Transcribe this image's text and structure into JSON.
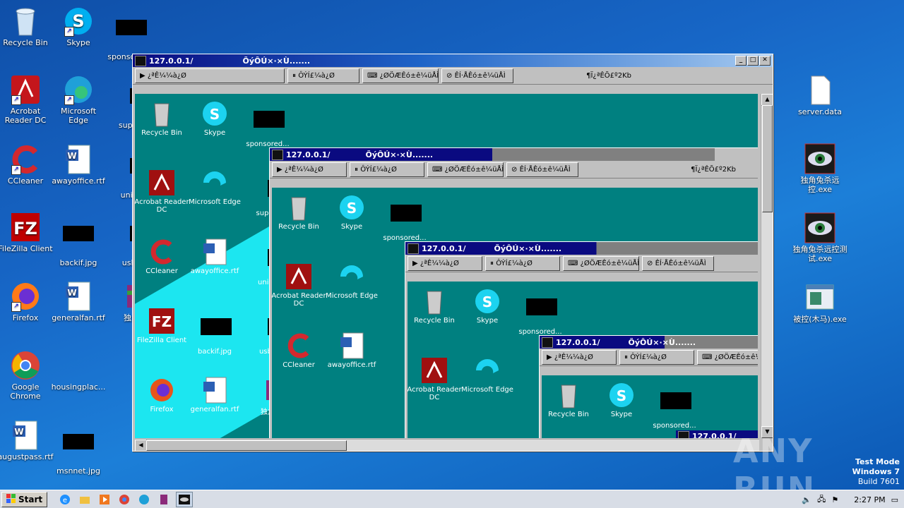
{
  "desktop": {
    "left_icons": [
      {
        "label": "Recycle Bin",
        "icon": "recycle-bin"
      },
      {
        "label": "Skype",
        "icon": "skype"
      },
      {
        "label": "sponsored...",
        "icon": "redacted"
      },
      {
        "label": "Acrobat Reader DC",
        "icon": "acrobat"
      },
      {
        "label": "Microsoft Edge",
        "icon": "edge"
      },
      {
        "label": "supply",
        "icon": "redacted"
      },
      {
        "label": "CCleaner",
        "icon": "ccleaner"
      },
      {
        "label": "awayoffice.rtf",
        "icon": "word-doc"
      },
      {
        "label": "union",
        "icon": "redacted"
      },
      {
        "label": "FileZilla Client",
        "icon": "filezilla"
      },
      {
        "label": "backif.jpg",
        "icon": "redacted"
      },
      {
        "label": "usbe",
        "icon": "redacted"
      },
      {
        "label": "Firefox",
        "icon": "firefox"
      },
      {
        "label": "generalfan.rtf",
        "icon": "word-doc"
      },
      {
        "label": "独角",
        "icon": "winrar"
      },
      {
        "label": "Google Chrome",
        "icon": "chrome"
      },
      {
        "label": "housingplac...",
        "icon": "blank"
      },
      {
        "label": "augustpass.rtf",
        "icon": "word-doc"
      },
      {
        "label": "msnnet.jpg",
        "icon": "redacted"
      }
    ],
    "right_icons": [
      {
        "label": "server.data",
        "icon": "blank-file"
      },
      {
        "label": "独角兔杀远控.exe",
        "icon": "eye-exe"
      },
      {
        "label": "独角兔杀远控测试.exe",
        "icon": "eye-exe"
      },
      {
        "label": "被控(木马).exe",
        "icon": "exe-window"
      }
    ]
  },
  "rat_window": {
    "title": "127.0.0.1/",
    "title_extra": "ÕýÔÚ×·×Ù.......",
    "buttons": {
      "minimize": "_",
      "maximize": "□",
      "close": "✕"
    },
    "toolbar": [
      {
        "label": "¿ªÊ¼¼à¿Ø",
        "icon": "play-icon"
      },
      {
        "label": "ÔÝÍ£¼à¿Ø",
        "icon": "pause-icon"
      },
      {
        "label": "¿ØÖÆÊó±ê¼üÅÌ",
        "icon": "keyboard-icon"
      },
      {
        "label": "ÊÍ·ÅÊó±ê¼üÅÌ",
        "icon": "release-icon"
      }
    ],
    "status": "¶Ï¿ªÊÕ£º2Kb",
    "remote_icons": [
      "Recycle Bin",
      "Skype",
      "sponsored...",
      "Acrobat Reader DC",
      "Microsoft Edge",
      "supply",
      "CCleaner",
      "awayoffice.rtf",
      "union",
      "FileZilla Client",
      "backif.jpg",
      "usbe",
      "Firefox",
      "generalfan.rtf",
      "独角"
    ]
  },
  "watermark": {
    "text": "ANY RUN"
  },
  "test_mode": {
    "line1": "Test Mode",
    "line2": "Windows 7",
    "line3": "Build 7601"
  },
  "taskbar": {
    "start_label": "Start",
    "clock": "2:27 PM"
  },
  "colors": {
    "desktop": "#1766c6",
    "remote_bg": "#008080",
    "title_active": "#0a0a80"
  }
}
